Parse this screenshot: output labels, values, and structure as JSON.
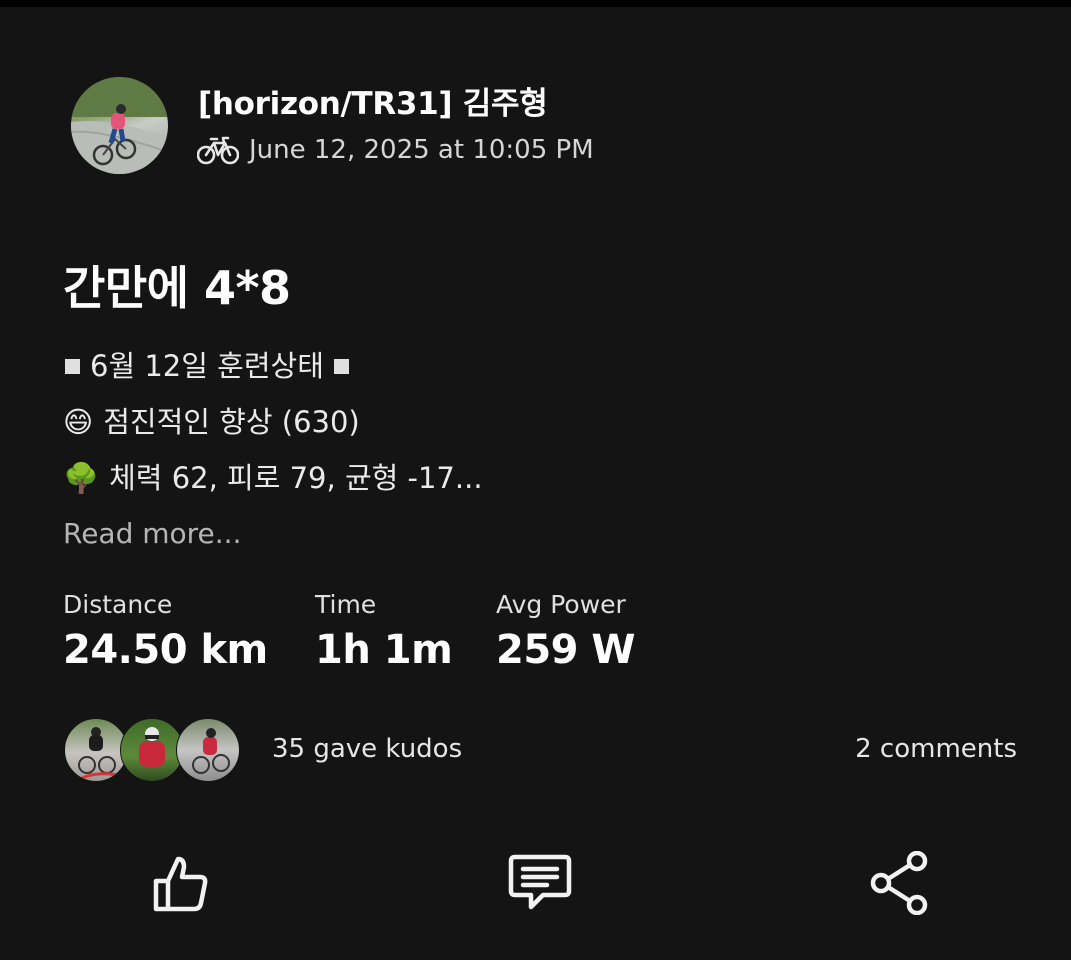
{
  "post": {
    "author": "[horizon/TR31] 김주형",
    "activity_icon": "bike-icon",
    "date": "June 12, 2025 at 10:05 PM",
    "title": "간만에 4*8",
    "description": {
      "line1_text": "6월 12일 훈련상태",
      "line2_emoji": "😄",
      "line2_text": "점진적인 향상 (630)",
      "line3_emoji": "🌳",
      "line3_text": "체력 62, 피로 79, 균형 -17..."
    },
    "read_more": "Read more..."
  },
  "stats": [
    {
      "label": "Distance",
      "value": "24.50 km"
    },
    {
      "label": "Time",
      "value": "1h 1m"
    },
    {
      "label": "Avg Power",
      "value": "259 W"
    }
  ],
  "social": {
    "kudos": "35 gave kudos",
    "comments": "2 comments"
  },
  "actions": {
    "kudos_icon": "thumbs-up-icon",
    "comment_icon": "comment-icon",
    "share_icon": "share-icon"
  },
  "colors": {
    "background": "#141414",
    "text": "#ffffff",
    "muted": "#b5b5b5"
  }
}
